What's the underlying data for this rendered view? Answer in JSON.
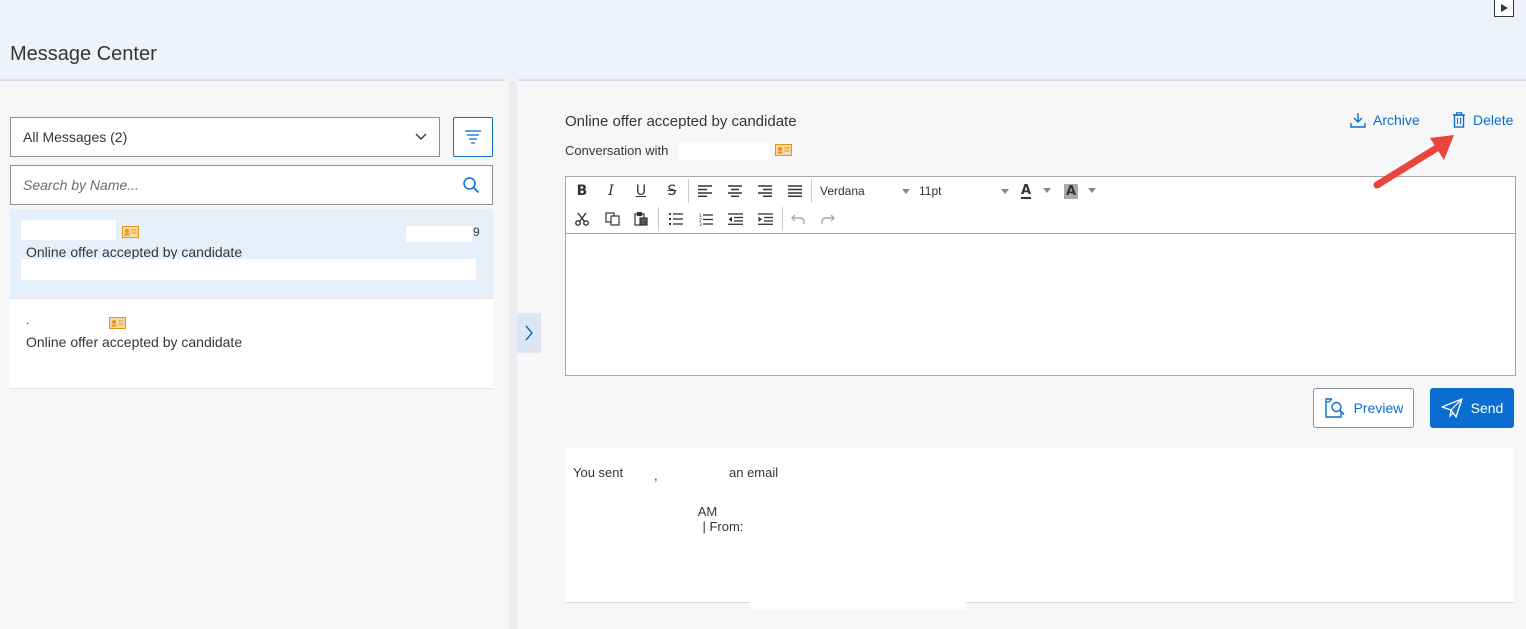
{
  "header": {
    "title": "Message Center"
  },
  "left": {
    "filter_select": {
      "value": "All Messages (2)"
    },
    "search": {
      "placeholder": "Search by Name..."
    },
    "items": [
      {
        "subject": "Online offer accepted by candidate",
        "date_fragment": "9"
      },
      {
        "name_fragment": ".",
        "subject": "Online offer accepted by candidate"
      }
    ]
  },
  "conversation": {
    "title": "Online offer accepted by candidate",
    "with_label": "Conversation with",
    "archive_label": "Archive",
    "delete_label": "Delete"
  },
  "editor": {
    "font": "Verdana",
    "size": "11pt",
    "bold_glyph": "B",
    "italic_glyph": "I",
    "underline_glyph": "U",
    "strike_glyph": "S",
    "text_color_glyph": "A",
    "bg_color_glyph": "A"
  },
  "actions": {
    "preview_label": "Preview",
    "send_label": "Send"
  },
  "history": {
    "sent_prefix": "You sent",
    "sent_suffix": "an email",
    "time_fragment": "AM",
    "from_label": "| From:",
    "comma": ","
  },
  "colors": {
    "accent": "#0a6ed1",
    "header_bg": "#eef3fa",
    "selected_row": "#e5f0fa",
    "annotation_arrow": "#e8453c"
  }
}
